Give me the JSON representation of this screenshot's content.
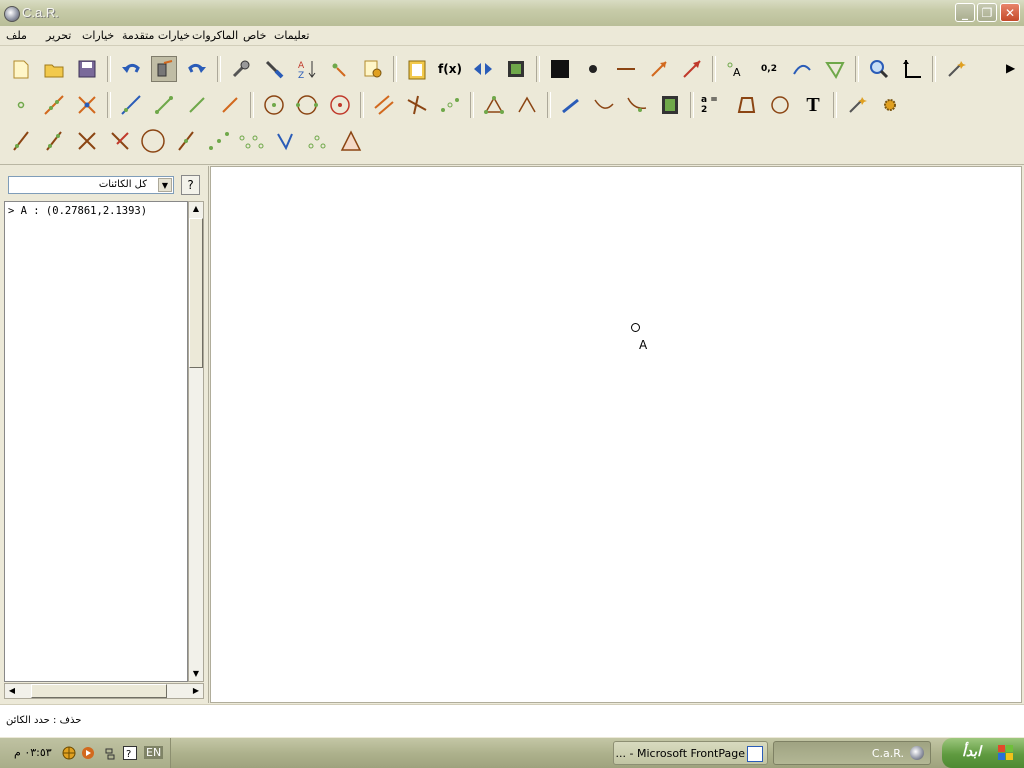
{
  "window": {
    "title": "C.a.R."
  },
  "menu": {
    "items": [
      "ملف",
      "تحرير",
      "خيارات",
      "خيارات متقدمة",
      "الماكروات",
      "خاص",
      "تعليمات"
    ]
  },
  "toolbar": {
    "fx_label": "f(x)",
    "coord_label": "0,2",
    "a2_label": "a = 2",
    "text_tool": "T",
    "point_label_tool": "A",
    "sort_az": "A Z"
  },
  "sidebar": {
    "filter_value": "كل الكائنات",
    "help": "?",
    "objects": [
      "> A : (0.27861,2.1393)"
    ]
  },
  "canvas": {
    "point_label": "A"
  },
  "status": {
    "text": "حذف : حدد الكائن"
  },
  "taskbar": {
    "clock": "٠٣:٥٣ م",
    "lang": "EN",
    "tasks": [
      "... - Microsoft FrontPage",
      "C.a.R."
    ],
    "start_label": "ابدأ"
  },
  "colors": {
    "tool_orange": "#d2691e",
    "tool_green": "#6fa84a",
    "tool_blue": "#2a5cb8",
    "accent": "#4e8a33"
  }
}
